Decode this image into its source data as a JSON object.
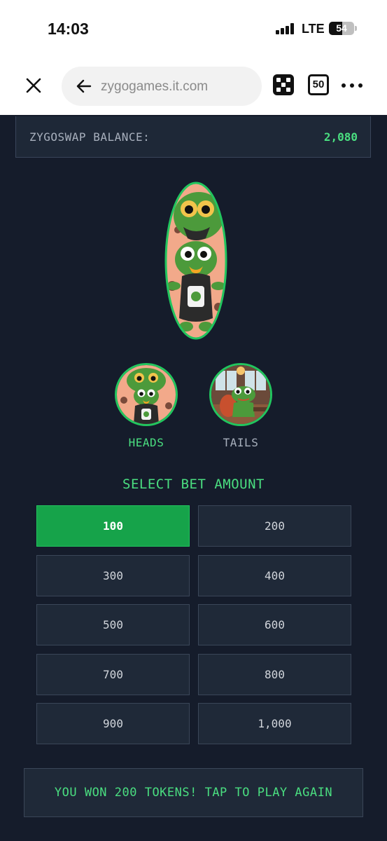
{
  "status_bar": {
    "time": "14:03",
    "network": "LTE",
    "battery": "54",
    "battery_level_percent": 54
  },
  "browser": {
    "url": "zygogames.it.com",
    "tab_count": "50",
    "icons": [
      "close-icon",
      "back-arrow-icon",
      "dice-icon",
      "tabs-icon",
      "more-icon"
    ]
  },
  "game": {
    "balance_label": "ZYGOSWAP BALANCE:",
    "balance_value": "2,080",
    "choices": [
      {
        "label": "HEADS",
        "selected": true
      },
      {
        "label": "TAILS",
        "selected": false
      }
    ],
    "select_title": "SELECT BET AMOUNT",
    "bets": [
      {
        "label": "100",
        "selected": true
      },
      {
        "label": "200",
        "selected": false
      },
      {
        "label": "300",
        "selected": false
      },
      {
        "label": "400",
        "selected": false
      },
      {
        "label": "500",
        "selected": false
      },
      {
        "label": "600",
        "selected": false
      },
      {
        "label": "700",
        "selected": false
      },
      {
        "label": "800",
        "selected": false
      },
      {
        "label": "900",
        "selected": false
      },
      {
        "label": "1,000",
        "selected": false
      }
    ],
    "result_message": "YOU WON 200 TOKENS! TAP TO PLAY AGAIN"
  },
  "colors": {
    "background": "#151c2b",
    "panel": "#1f2938",
    "accent_green": "#4ade80",
    "selected_green": "#16a34a"
  }
}
